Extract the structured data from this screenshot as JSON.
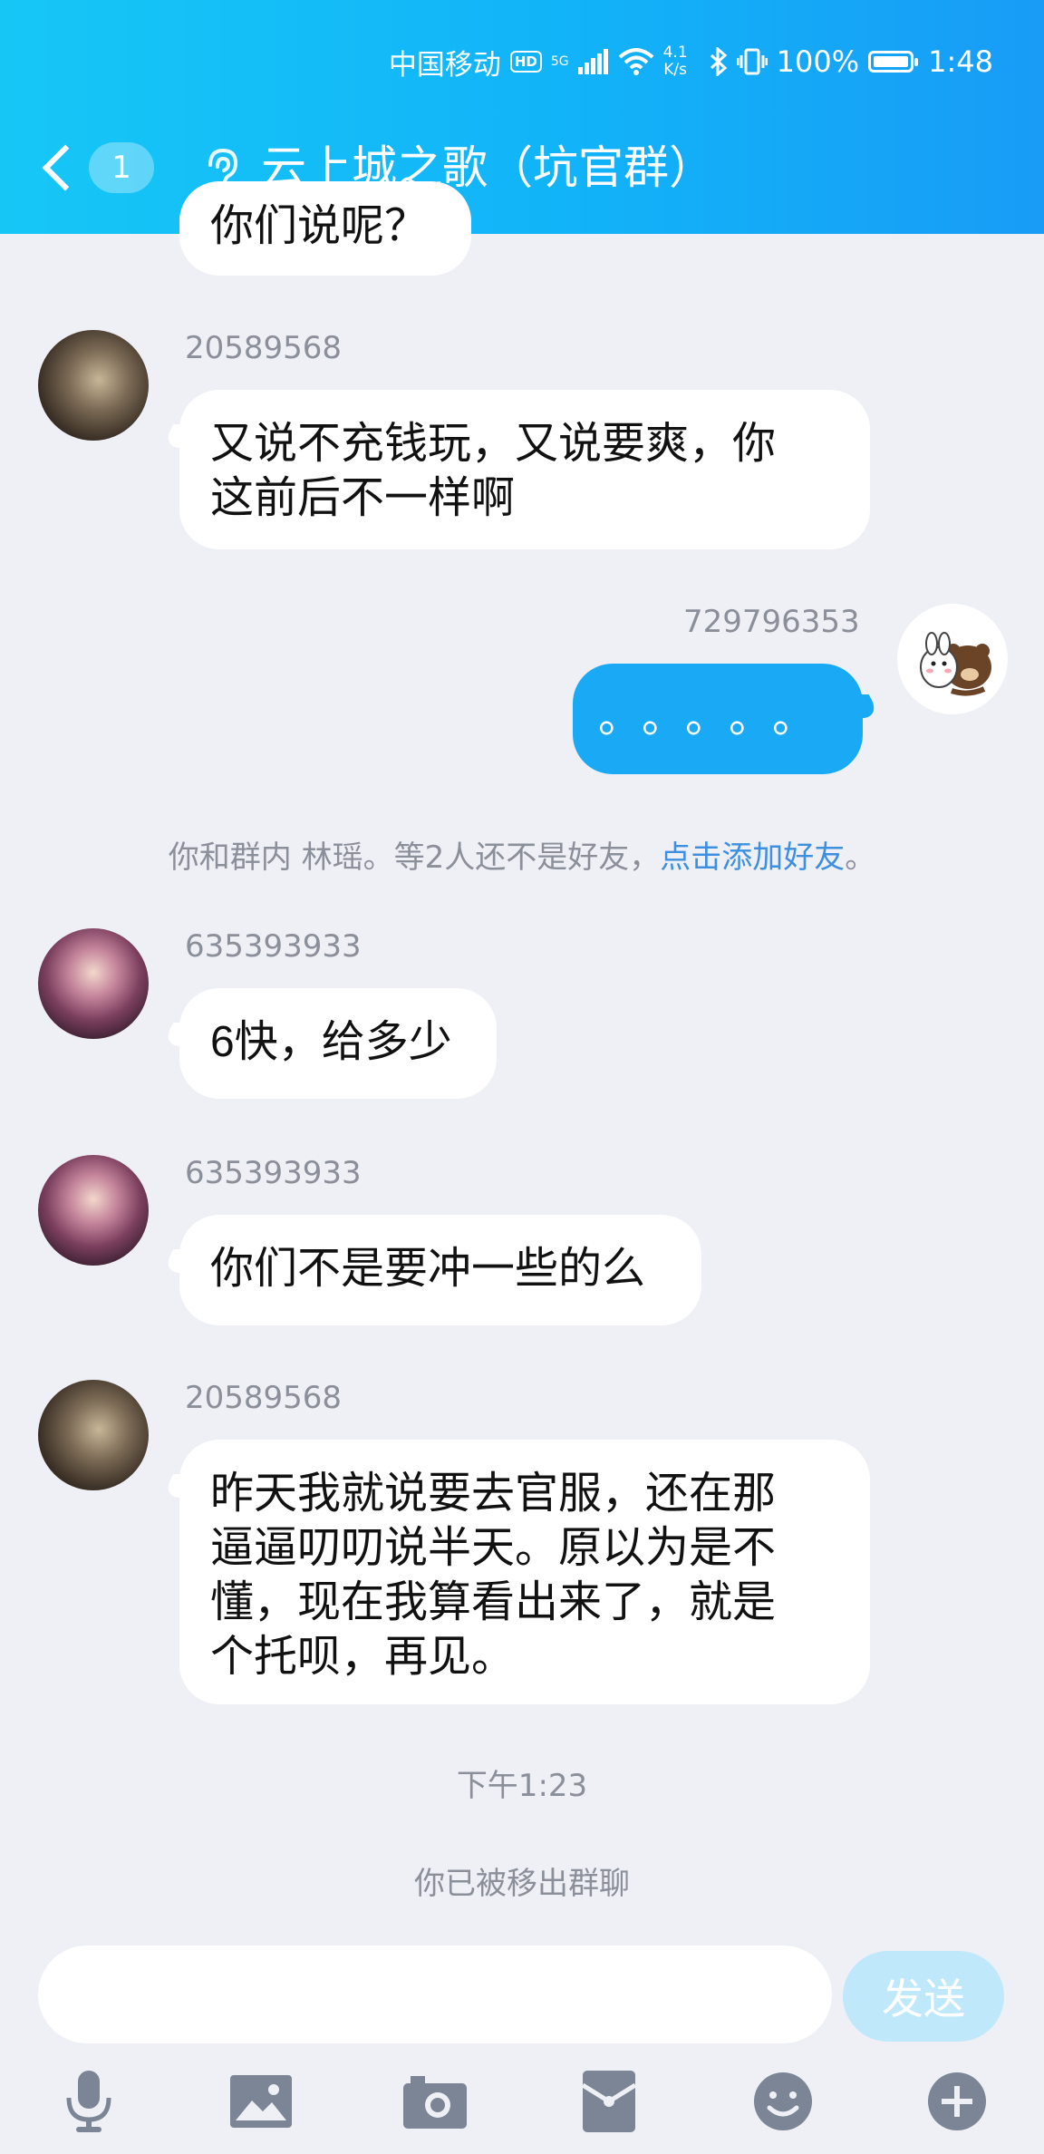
{
  "status_bar": {
    "carrier": "中国移动",
    "hd": "HD",
    "network": "5G",
    "net_speed_value": "4.1",
    "net_speed_unit": "K/s",
    "battery": "100%",
    "time": "1:48"
  },
  "header": {
    "unread_count": "1",
    "title": "云上城之歌（坑官群）"
  },
  "messages": [
    {
      "sender": "20589568",
      "text_lines": [
        "又说不充钱玩，又说要爽，你",
        "这前后不一样啊"
      ]
    },
    {
      "sender": "729796353",
      "text": "。。。。。"
    },
    {
      "sender": "635393933",
      "text": "6快，给多少"
    },
    {
      "sender": "635393933",
      "text": "你们不是要冲一些的么"
    },
    {
      "sender": "20589568",
      "text_lines": [
        "昨天我就说要去官服，还在那",
        "逼逼叨叨说半天。原以为是不",
        "懂，现在我算看出来了，就是",
        "个托呗，再见。"
      ]
    }
  ],
  "partial_top_text": "你们说呢？",
  "system": {
    "friend_notice": "你和群内 林瑶。等2人还不是好友，",
    "friend_link": "点击添加好友",
    "friend_notice_end": "。",
    "timestamp": "下午1:23",
    "removed_notice": "你已被移出群聊"
  },
  "input": {
    "placeholder": "",
    "send_label": "发送"
  },
  "toolbar": {
    "icons": [
      "microphone-icon",
      "image-icon",
      "camera-icon",
      "red-envelope-icon",
      "emoji-icon",
      "plus-icon"
    ]
  },
  "colors": {
    "header_start": "#16c7f6",
    "header_end": "#189cf6",
    "my_bubble": "#1aaaf5",
    "link": "#3d8fe0",
    "background": "#eef0f5"
  }
}
